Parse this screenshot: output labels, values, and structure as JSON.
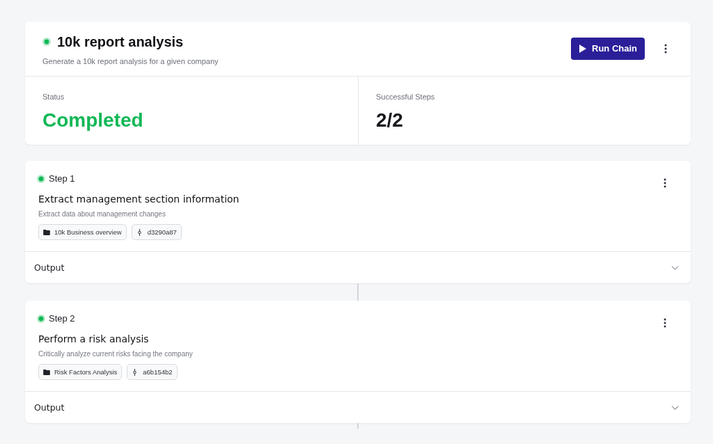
{
  "chain": {
    "title": "10k report analysis",
    "color": "#12b856",
    "description": "Generate a 10k report analysis for a given company",
    "run_button": "Run Chain"
  },
  "stats": [
    {
      "kind": "status",
      "label": "Status",
      "value": "Completed"
    },
    {
      "kind": "count",
      "label": "Successful Steps",
      "value": "2/2"
    }
  ],
  "steps": [
    {
      "label": "Step 1",
      "color": "#12b856",
      "title": "Extract management section information",
      "description": "Extract data about management changes",
      "tags": [
        {
          "kind": "folder",
          "text": "10k Business overview"
        },
        {
          "kind": "commit",
          "text": "d3290a87"
        }
      ],
      "output": {
        "label": "Output",
        "expanded": false
      }
    },
    {
      "label": "Step 2",
      "color": "#12b856",
      "title": "Perform a risk analysis",
      "description": "Critically analyze current risks facing the company",
      "tags": [
        {
          "kind": "folder",
          "text": "Risk Factors Analysis"
        },
        {
          "kind": "commit",
          "text": "a6b154b2"
        }
      ],
      "output": {
        "label": "Output",
        "expanded": false
      }
    }
  ]
}
